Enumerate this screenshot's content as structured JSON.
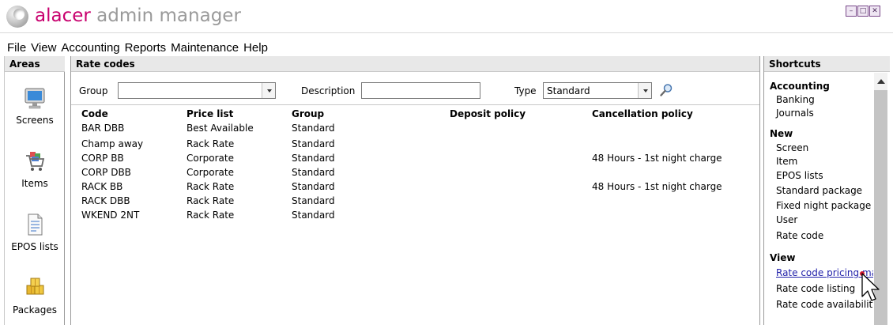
{
  "app": {
    "brand": "alacer",
    "subtitle": " admin manager"
  },
  "window_controls": [
    "minimize-icon",
    "maximize-icon",
    "close-icon"
  ],
  "menu": [
    "File",
    "View",
    "Accounting",
    "Reports",
    "Maintenance",
    "Help"
  ],
  "areas": {
    "title": "Areas",
    "items": [
      {
        "label": "Screens",
        "icon": "monitor-icon"
      },
      {
        "label": "Items",
        "icon": "shopping-cart-icon"
      },
      {
        "label": "EPOS lists",
        "icon": "document-list-icon"
      },
      {
        "label": "Packages",
        "icon": "package-boxes-icon"
      }
    ]
  },
  "main": {
    "title": "Rate codes",
    "filters": {
      "group_label": "Group",
      "group_value": "",
      "description_label": "Description",
      "description_value": "",
      "type_label": "Type",
      "type_value": "Standard"
    },
    "columns": [
      "Code",
      "Price list",
      "Group",
      "Deposit policy",
      "Cancellation policy"
    ],
    "rows": [
      [
        "BAR DBB",
        "Best Available",
        "Standard",
        "",
        ""
      ],
      [
        "Champ away",
        "Rack Rate",
        "Standard",
        "",
        ""
      ],
      [
        "CORP BB",
        "Corporate",
        "Standard",
        "",
        "48 Hours - 1st night charge"
      ],
      [
        "CORP DBB",
        "Corporate",
        "Standard",
        "",
        ""
      ],
      [
        "RACK BB",
        "Rack Rate",
        "Standard",
        "",
        "48 Hours - 1st night charge"
      ],
      [
        "RACK DBB",
        "Rack Rate",
        "Standard",
        "",
        ""
      ],
      [
        "WKEND 2NT",
        "Rack Rate",
        "Standard",
        "",
        ""
      ]
    ]
  },
  "shortcuts": {
    "title": "Shortcuts",
    "groups": [
      {
        "name": "Accounting",
        "items": [
          "Banking",
          "Journals"
        ]
      },
      {
        "name": "New",
        "items": [
          "Screen",
          "Item",
          "EPOS lists",
          "Standard package",
          "Fixed night package",
          "User",
          "Rate code"
        ]
      },
      {
        "name": "View",
        "items": [
          "Rate code pricing map",
          "Rate code listing",
          "Rate code availability"
        ]
      }
    ]
  },
  "colors": {
    "brand": "#c8006e",
    "subtitle": "#9a9a9a",
    "link_active": "#2222aa"
  }
}
